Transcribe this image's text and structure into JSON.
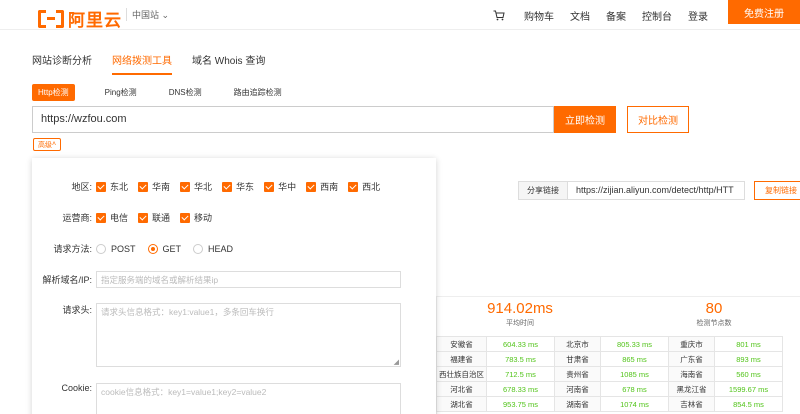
{
  "header": {
    "logo_text": "阿里云",
    "site_switch": "中国站",
    "nav": [
      "购物车",
      "文档",
      "备案",
      "控制台",
      "登录"
    ],
    "register": "免费注册"
  },
  "main_tabs": [
    "网站诊断分析",
    "网络拨测工具",
    "域名 Whois 查询"
  ],
  "sub_tabs": [
    "Http检测",
    "Ping检测",
    "DNS检测",
    "路由追踪检测"
  ],
  "url_value": "https://wzfou.com",
  "buttons": {
    "detect": "立即检测",
    "compare": "对比检测",
    "advanced": "高级"
  },
  "panel": {
    "region_label": "地区:",
    "regions": [
      "东北",
      "华南",
      "华北",
      "华东",
      "华中",
      "西南",
      "西北"
    ],
    "isp_label": "运营商:",
    "isps": [
      "电信",
      "联通",
      "移动"
    ],
    "method_label": "请求方法:",
    "methods": [
      "POST",
      "GET",
      "HEAD"
    ],
    "resolve_label": "解析域名/IP:",
    "resolve_placeholder": "指定服务端的域名或解析结果ip",
    "headers_label": "请求头:",
    "headers_placeholder": "请求头信息格式：key1:value1，多条回车换行",
    "cookie_label": "Cookie:",
    "cookie_placeholder": "cookie信息格式：key1=value1;key2=value2"
  },
  "share": {
    "label": "分享链接",
    "url": "https://zijian.aliyun.com/detect/http/HTT",
    "copy": "复制链接"
  },
  "stats": [
    {
      "value": "914.02ms",
      "label": "平均时间"
    },
    {
      "value": "80",
      "label": "检测节点数"
    }
  ],
  "table": [
    [
      "安徽省",
      "604.33 ms",
      "北京市",
      "805.33 ms",
      "重庆市",
      "801 ms"
    ],
    [
      "福建省",
      "783.5 ms",
      "甘肃省",
      "865 ms",
      "广东省",
      "893 ms"
    ],
    [
      "西壮族自治区",
      "712.5 ms",
      "贵州省",
      "1085 ms",
      "海南省",
      "560 ms"
    ],
    [
      "河北省",
      "678.33 ms",
      "河南省",
      "678 ms",
      "黑龙江省",
      "1599.67 ms"
    ],
    [
      "湖北省",
      "953.75 ms",
      "湖南省",
      "1074 ms",
      "吉林省",
      "854.5 ms"
    ]
  ],
  "colors": {
    "accent": "#ff6a00",
    "ok": "#52c41a"
  }
}
